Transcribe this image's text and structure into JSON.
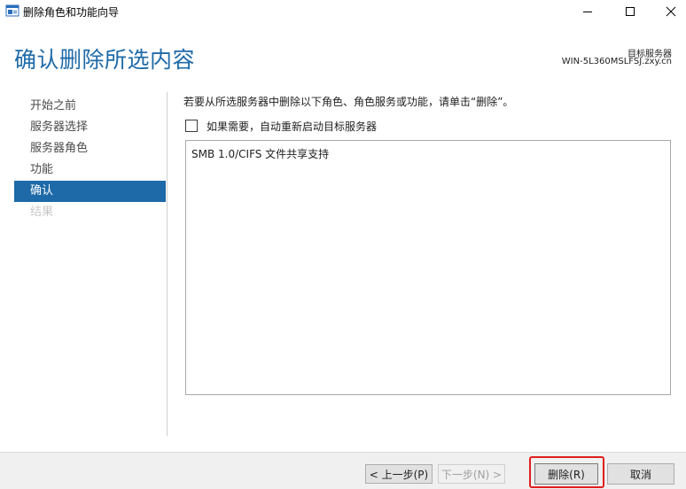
{
  "window": {
    "title": "删除角色和功能向导",
    "controls": [
      "minimize-icon",
      "maximize-icon",
      "close-icon"
    ]
  },
  "header": {
    "title": "确认删除所选内容",
    "target_label": "目标服务器",
    "target_server": "WIN-5L360MSLFSJ.zxy.cn"
  },
  "nav": {
    "items": [
      {
        "label": "开始之前",
        "state": "normal"
      },
      {
        "label": "服务器选择",
        "state": "normal"
      },
      {
        "label": "服务器角色",
        "state": "normal"
      },
      {
        "label": "功能",
        "state": "normal"
      },
      {
        "label": "确认",
        "state": "active"
      },
      {
        "label": "结果",
        "state": "disabled"
      }
    ]
  },
  "main": {
    "instruction": "若要从所选服务器中删除以下角色、角色服务或功能，请单击“删除”。",
    "restart_label": "如果需要，自动重新启动目标服务器",
    "restart_checked": false,
    "selected_items": [
      "SMB 1.0/CIFS 文件共享支持"
    ]
  },
  "footer": {
    "prev_label": "< 上一步(P)",
    "next_label": "下一步(N) >",
    "delete_label": "删除(R)",
    "cancel_label": "取消"
  },
  "colors": {
    "accent": "#1e6aa8",
    "highlight": "#e01e1e"
  }
}
